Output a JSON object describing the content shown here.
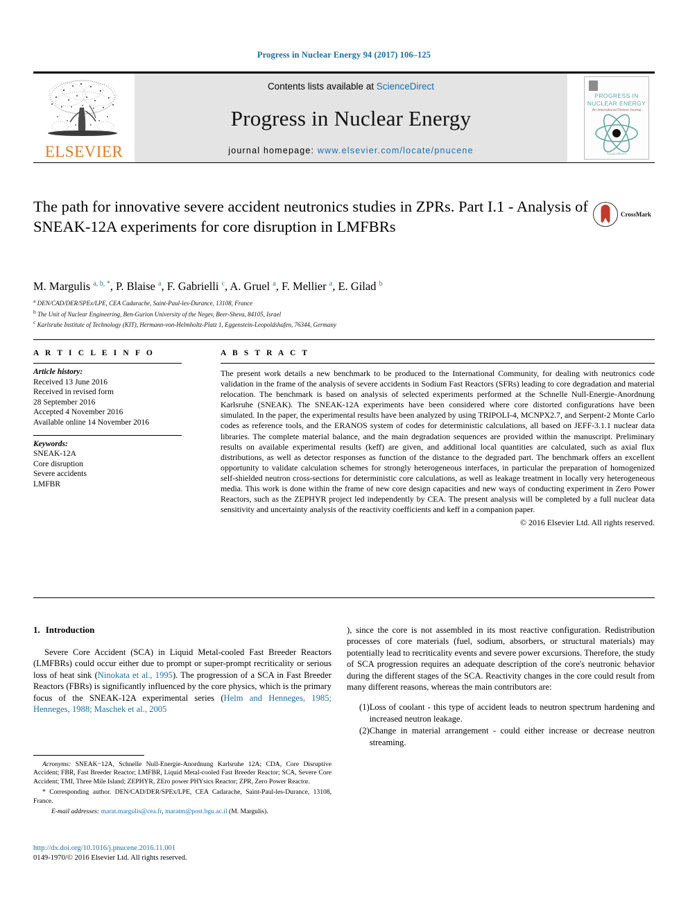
{
  "running_head": "Progress in Nuclear Energy 94 (2017) 106–125",
  "masthead": {
    "elsevier_wordmark": "ELSEVIER",
    "contents_prefix": "Contents lists available at ",
    "contents_link": "ScienceDirect",
    "journal_name": "Progress in Nuclear Energy",
    "homepage_prefix": "journal homepage: ",
    "homepage_url": "www.elsevier.com/locate/pnucene",
    "cover": {
      "line1": "PROGRESS IN",
      "line2": "NUCLEAR ENERGY",
      "subtitle": "An International Review Journal",
      "footer": "ScienceDirect"
    }
  },
  "article": {
    "title": "The path for innovative severe accident neutronics studies in ZPRs. Part I.1 - Analysis of SNEAK-12A experiments for core disruption in LMFBRs",
    "crossmark_label": "CrossMark",
    "authors_html": "M. Margulis <sup>a, b, *</sup>, P. Blaise <sup>a</sup>, F. Gabrielli <sup>c</sup>, A. Gruel <sup>a</sup>, F. Mellier <sup>a</sup>, E. Gilad <sup>b</sup>",
    "affiliations": [
      {
        "mark": "a",
        "text": "DEN/CAD/DER/SPEx/LPE, CEA Cadarache, Saint-Paul-les-Durance, 13108, France"
      },
      {
        "mark": "b",
        "text": "The Unit of Nuclear Engineering, Ben-Gurion University of the Negev, Beer-Sheva, 84105, Israel"
      },
      {
        "mark": "c",
        "text": "Karlsruhe Institute of Technology (KIT), Hermann-von-Helmholtz-Platz 1, Eggenstein-Leopoldshafen, 76344, Germany"
      }
    ]
  },
  "article_info": {
    "heading": "A R T I C L E  I N F O",
    "history_label": "Article history:",
    "history": [
      "Received 13 June 2016",
      "Received in revised form",
      "28 September 2016",
      "Accepted 4 November 2016",
      "Available online 14 November 2016"
    ],
    "keywords_label": "Keywords:",
    "keywords": [
      "SNEAK-12A",
      "Core disruption",
      "Severe accidents",
      "LMFBR"
    ]
  },
  "abstract": {
    "heading": "A B S T R A C T",
    "paragraph": "The present work details a new benchmark to be produced to the International Community, for dealing with neutronics code validation in the frame of the analysis of severe accidents in Sodium Fast Reactors (SFRs) leading to core degradation and material relocation. The benchmark is based on analysis of selected experiments performed at the Schnelle Null-Energie-Anordnung Karlsruhe (SNEAK). The SNEAK-12A experiments have been considered where core distorted configurations have been simulated. In the paper, the experimental results have been analyzed by using TRIPOLI-4, MCNPX2.7, and Serpent-2 Monte Carlo codes as reference tools, and the ERANOS system of codes for deterministic calculations, all based on JEFF-3.1.1 nuclear data libraries. The complete material balance, and the main degradation sequences are provided within the manuscript. Preliminary results on available experimental results (keff) are given, and additional local quantities are calculated, such as axial flux distributions, as well as detector responses as function of the distance to the degraded part. The benchmark offers an excellent opportunity to validate calculation schemes for strongly heterogeneous interfaces, in particular the preparation of homogenized self-shielded neutron cross-sections for deterministic core calculations, as well as leakage treatment in locally very heterogeneous media. This work is done within the frame of new core design capacities and new ways of conducting experiment in Zero Power Reactors, such as the ZEPHYR project led independently by CEA. The present analysis will be completed by a full nuclear data sensitivity and uncertainty analysis of the reactivity coefficients and keff in a companion paper.",
    "copyright": "© 2016 Elsevier Ltd. All rights reserved."
  },
  "introduction": {
    "number": "1.",
    "heading": "Introduction",
    "para1_a": "Severe Core Accident (SCA) in Liquid Metal-cooled Fast Breeder Reactors (LMFBRs) could occur either due to prompt or super-prompt recriticality or serious loss of heat sink (",
    "para1_cite1": "Ninokata et al., 1995",
    "para1_b": "). The progression of a SCA in Fast Breeder Reactors (FBRs) is significantly influenced by the core physics, which is the primary focus of the SNEAK-12A experimental series (",
    "para1_cite2": "Helm and Henneges, 1985; Henneges, 1988; Maschek et al., 2005",
    "para1_c": "), since the core is not assembled in its most reactive configuration. Redistribution processes of core materials (fuel, sodium, absorbers, or structural materials) may potentially lead to recriticality events and severe power excursions. Therefore, the study of SCA progression requires an adequate description of the core's neutronic behavior during the different stages of the SCA. Reactivity changes in the core could result from many different reasons, whereas the main contributors are:",
    "list": [
      {
        "marker": "(1)",
        "text": "Loss of coolant - this type of accident leads to neutron spectrum hardening and increased neutron leakage."
      },
      {
        "marker": "(2)",
        "text": "Change in material arrangement - could either increase or decrease neutron streaming."
      }
    ]
  },
  "footnotes": {
    "acronyms_label": "Acronyms:",
    "acronyms_text": " SNEAK−12A, Schnelle Null-Energie-Anordnung Karlsruhe 12A; CDA, Core Disruptive Accident; FBR, Fast Breeder Reactor; LMFBR, Liquid Metal-cooled Fast Breeder Reactor; SCA, Severe Core Accident; TMI, Three Mile Island; ZEPHYR, ZEro power PHYsics Reactor; ZPR, Zero Power Reactor.",
    "corresponding_marker": "*",
    "corresponding_text": "Corresponding author. DEN/CAD/DER/SPEx/LPE, CEA Cadarache, Saint-Paul-les-Durance, 13108, France.",
    "email_label": "E-mail addresses:",
    "email1": "marat.margulis@cea.fr",
    "email_sep": ", ",
    "email2": "maratm@post.bgu.ac.il",
    "email_tail": " (M. Margulis).",
    "doi": "http://dx.doi.org/10.1016/j.pnucene.2016.11.001",
    "issn": "0149-1970/© 2016 Elsevier Ltd. All rights reserved."
  },
  "colors": {
    "link": "#1a6ea8",
    "elsevier_orange": "#e87722",
    "masthead_gray": "#e4e4e4",
    "cover_teal": "#5fa6a8",
    "crossmark_red": "#c0392b"
  }
}
